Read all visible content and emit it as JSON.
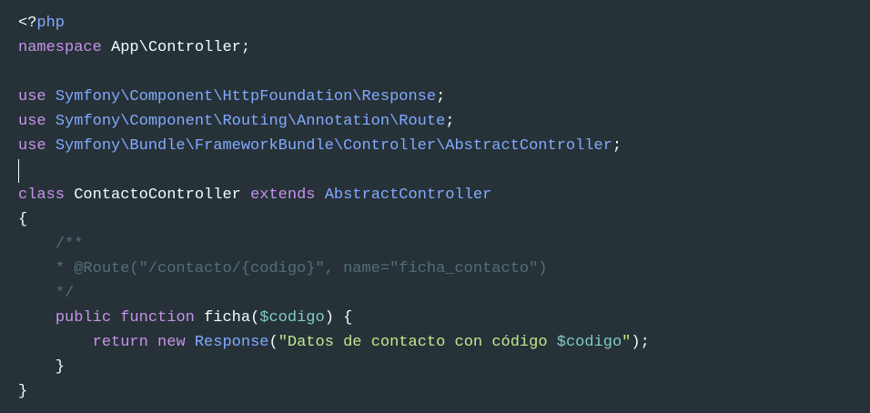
{
  "colors": {
    "background": "#263238",
    "text": "#eeffff",
    "keyword": "#c792ea",
    "type": "#82aaff",
    "comment": "#546e7a",
    "variable": "#80cbc4",
    "string": "#c3e88d"
  },
  "code": {
    "lines": [
      [
        {
          "t": "plain",
          "v": "<?"
        },
        {
          "t": "type",
          "v": "php"
        }
      ],
      [
        {
          "t": "keyword",
          "v": "namespace"
        },
        {
          "t": "plain",
          "v": " App\\Controller;"
        }
      ],
      [],
      [
        {
          "t": "keyword",
          "v": "use"
        },
        {
          "t": "plain",
          "v": " "
        },
        {
          "t": "type",
          "v": "Symfony\\Component\\HttpFoundation\\Response"
        },
        {
          "t": "plain",
          "v": ";"
        }
      ],
      [
        {
          "t": "keyword",
          "v": "use"
        },
        {
          "t": "plain",
          "v": " "
        },
        {
          "t": "type",
          "v": "Symfony\\Component\\Routing\\Annotation\\Route"
        },
        {
          "t": "plain",
          "v": ";"
        }
      ],
      [
        {
          "t": "keyword",
          "v": "use"
        },
        {
          "t": "plain",
          "v": " "
        },
        {
          "t": "type",
          "v": "Symfony\\Bundle\\FrameworkBundle\\Controller\\AbstractController"
        },
        {
          "t": "plain",
          "v": ";"
        }
      ],
      [],
      [
        {
          "t": "keyword",
          "v": "class"
        },
        {
          "t": "plain",
          "v": " ContactoController "
        },
        {
          "t": "keyword",
          "v": "extends"
        },
        {
          "t": "plain",
          "v": " "
        },
        {
          "t": "type",
          "v": "AbstractController"
        }
      ],
      [
        {
          "t": "plain",
          "v": "{"
        }
      ],
      [
        {
          "t": "plain",
          "v": "    "
        },
        {
          "t": "comment",
          "v": "/**"
        }
      ],
      [
        {
          "t": "plain",
          "v": "    "
        },
        {
          "t": "comment",
          "v": "* @Route(\"/contacto/{codigo}\", name=\"ficha_contacto\")"
        }
      ],
      [
        {
          "t": "plain",
          "v": "    "
        },
        {
          "t": "comment",
          "v": "*/"
        }
      ],
      [
        {
          "t": "plain",
          "v": "    "
        },
        {
          "t": "keyword",
          "v": "public"
        },
        {
          "t": "plain",
          "v": " "
        },
        {
          "t": "keyword",
          "v": "function"
        },
        {
          "t": "plain",
          "v": " ficha("
        },
        {
          "t": "var",
          "v": "$codigo"
        },
        {
          "t": "plain",
          "v": ") {"
        }
      ],
      [
        {
          "t": "plain",
          "v": "        "
        },
        {
          "t": "keyword",
          "v": "return"
        },
        {
          "t": "plain",
          "v": " "
        },
        {
          "t": "keyword",
          "v": "new"
        },
        {
          "t": "plain",
          "v": " "
        },
        {
          "t": "type",
          "v": "Response"
        },
        {
          "t": "plain",
          "v": "("
        },
        {
          "t": "string",
          "v": "\"Datos de contacto con código "
        },
        {
          "t": "var",
          "v": "$codigo"
        },
        {
          "t": "string",
          "v": "\""
        },
        {
          "t": "plain",
          "v": ");"
        }
      ],
      [
        {
          "t": "plain",
          "v": "    }"
        }
      ],
      [
        {
          "t": "plain",
          "v": "}"
        }
      ]
    ]
  }
}
